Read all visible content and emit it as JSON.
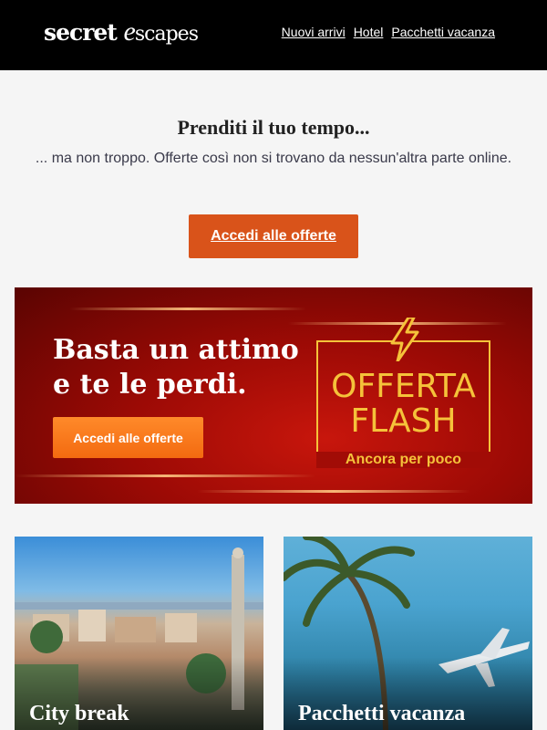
{
  "header": {
    "logo_word1": "secret",
    "logo_e": "e",
    "logo_rest": "scapes",
    "nav": [
      "Nuovi arrivi",
      "Hotel",
      "Pacchetti vacanza"
    ]
  },
  "intro": {
    "headline": "Prenditi il tuo tempo...",
    "subline": "... ma non troppo. Offerte così non si trovano da nessun'altra parte online.",
    "cta_label": "Accedi alle offerte"
  },
  "banner": {
    "title_line1": "Basta un attimo",
    "title_line2": "e te le perdi.",
    "button_label": "Accedi alle offerte",
    "flash_line1": "OFFERTA",
    "flash_line2": "FLASH",
    "flash_sub": "Ancora per poco",
    "icon": "lightning-bolt-icon"
  },
  "cards": [
    {
      "label": "City break"
    },
    {
      "label": "Pacchetti vacanza"
    }
  ],
  "colors": {
    "header_bg": "#000000",
    "cta": "#d9531a",
    "banner_button": "#f36a10",
    "flash_gold": "#f5c23a"
  }
}
